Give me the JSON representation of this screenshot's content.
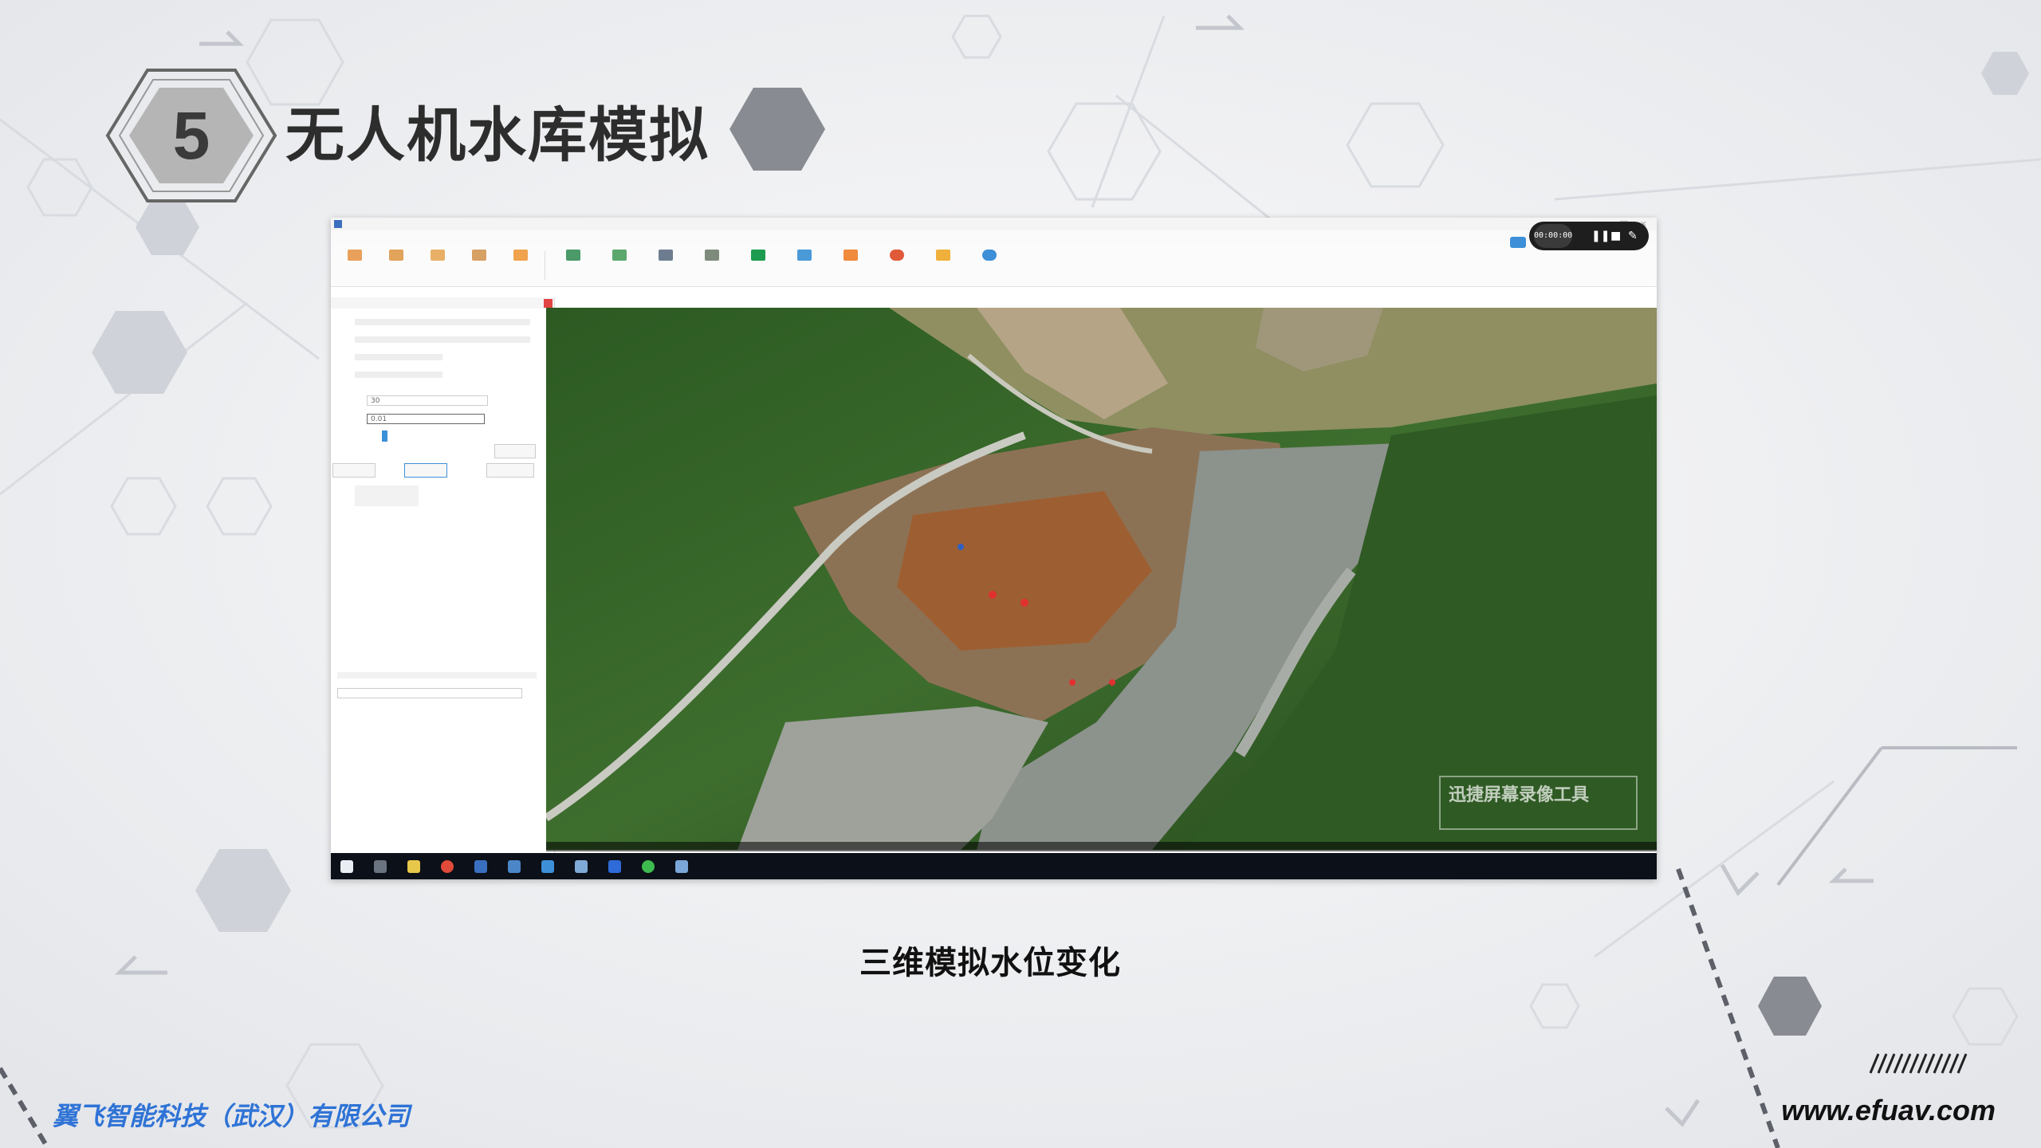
{
  "slide": {
    "number": "5",
    "title": "无人机水库模拟",
    "caption": "三维模拟水位变化",
    "company": "翼飞智能科技（武汉）有限公司",
    "website": "www.efuav.com"
  },
  "screenshot": {
    "recorder_time": "00:00:00",
    "panel_fields": {
      "speed_value": "30",
      "step_value": "0.01"
    },
    "map_watermark": "迅捷屏幕录像工具"
  },
  "colors": {
    "accent": "#2f73d6",
    "title": "#2d2d2d",
    "hex_dark": "#555555"
  },
  "icons": [
    "hexagon-icon",
    "arrow-icon",
    "camera-icon",
    "pause-icon",
    "stop-icon",
    "pen-icon",
    "close-icon"
  ]
}
